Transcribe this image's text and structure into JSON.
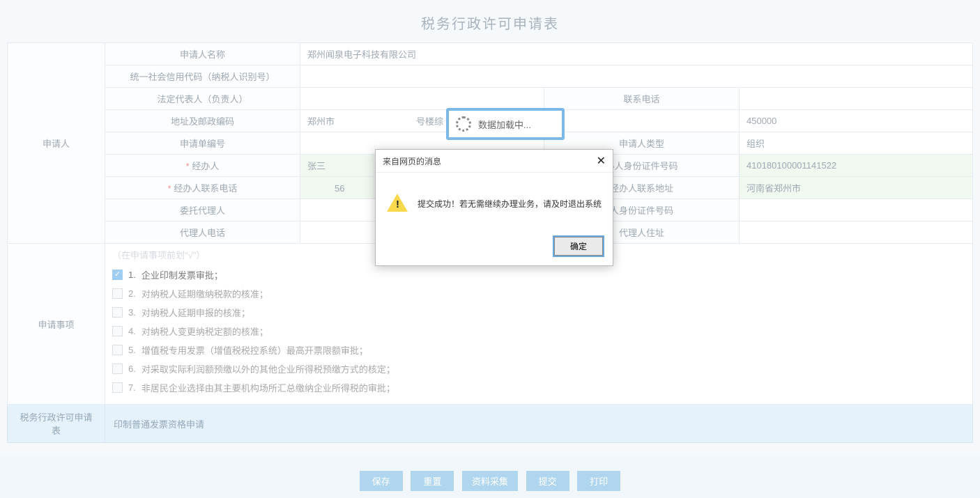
{
  "title": "税务行政许可申请表",
  "applicant": {
    "section_label": "申请人",
    "name_label": "申请人名称",
    "name_value": "郑州闻泉电子科技有限公司",
    "credit_code_label": "统一社会信用代码（纳税人识别号）",
    "credit_code_value": "　",
    "legal_rep_label": "法定代表人（负责人）",
    "legal_rep_value": "　",
    "phone_label": "联系电话",
    "phone_value": "",
    "addr_label": "地址及邮政编码",
    "addr_value": "郑州市　　　　　　　　　号楼综",
    "postcode_value": "450000",
    "app_no_label": "申请单编号",
    "app_no_value": "",
    "app_type_label": "申请人类型",
    "app_type_value": "组织",
    "handler_label": "经办人",
    "handler_value": "张三",
    "handler_id_label": "办人身份证件号码",
    "handler_id_value": "410180100001141522",
    "handler_phone_label": "经办人联系电话",
    "handler_phone_value": "　　　56",
    "handler_addr_label": "经办人联系地址",
    "handler_addr_value": "河南省郑州市",
    "agent_label": "委托代理人",
    "agent_value": "",
    "agent_id_label": "人身份证件号码",
    "agent_id_value": "",
    "agent_phone_label": "代理人电话",
    "agent_phone_value": "",
    "agent_addr_label": "代理人住址",
    "agent_addr_value": ""
  },
  "items_section": {
    "label": "申请事项",
    "hint": "（在申请事项前划\"√\"）",
    "options": [
      {
        "idx": "1.",
        "text": "企业印制发票审批；",
        "checked": true
      },
      {
        "idx": "2.",
        "text": "对纳税人延期缴纳税款的核准；",
        "checked": false
      },
      {
        "idx": "3.",
        "text": "对纳税人延期申报的核准；",
        "checked": false
      },
      {
        "idx": "4.",
        "text": "对纳税人变更纳税定额的核准；",
        "checked": false
      },
      {
        "idx": "5.",
        "text": "增值税专用发票（增值税税控系统）最高开票限额审批；",
        "checked": false
      },
      {
        "idx": "6.",
        "text": "对采取实际利润额预缴以外的其他企业所得税预缴方式的核定；",
        "checked": false
      },
      {
        "idx": "7.",
        "text": "非居民企业选择由其主要机构场所汇总缴纳企业所得税的审批；",
        "checked": false
      }
    ]
  },
  "permit_row": {
    "label": "税务行政许可申请表",
    "value": "印制普通发票资格申请"
  },
  "buttons": {
    "save": "保存",
    "reset": "重置",
    "collect": "资料采集",
    "submit": "提交",
    "print": "打印"
  },
  "loading": {
    "text": "数据加载中..."
  },
  "modal": {
    "title": "来自网页的消息",
    "message": "提交成功！若无需继续办理业务，请及时退出系统",
    "ok": "确定"
  }
}
